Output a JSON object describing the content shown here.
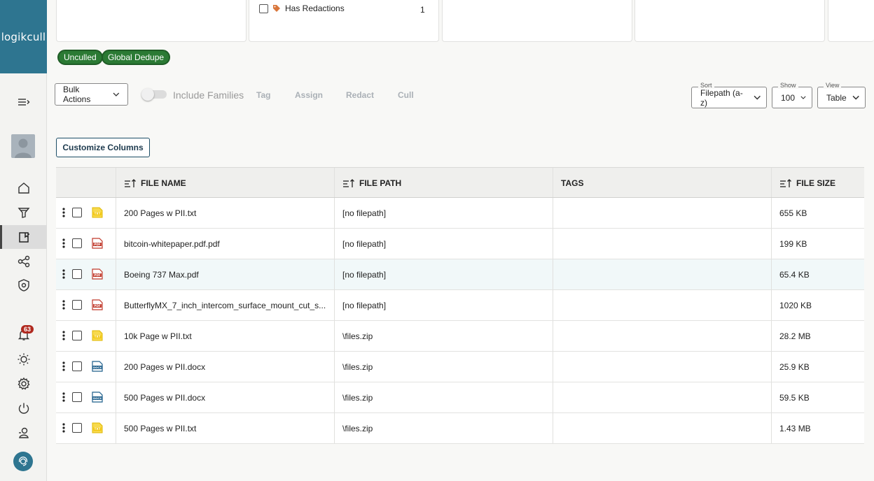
{
  "app": {
    "logo": "logikcull"
  },
  "sidebar": {
    "items": [
      {
        "name": "collapse-menu-icon"
      },
      {
        "name": "home-icon"
      },
      {
        "name": "upload-funnel-icon"
      },
      {
        "name": "review-book-icon",
        "active": true
      },
      {
        "name": "share-network-icon"
      },
      {
        "name": "shield-icon"
      },
      {
        "name": "notifications-bell-icon"
      },
      {
        "name": "sun-icon"
      },
      {
        "name": "settings-gear-icon"
      },
      {
        "name": "power-icon"
      },
      {
        "name": "account-icon"
      },
      {
        "name": "support-icon"
      }
    ],
    "notification_count": "63"
  },
  "facets": {
    "has_redactions_label": "Has Redactions",
    "has_redactions_count": "1"
  },
  "filters": {
    "pills": [
      "Unculled",
      "Global Dedupe"
    ],
    "pill_color": "#2b7a34"
  },
  "toolbar": {
    "bulk_actions": "Bulk Actions",
    "include_families": "Include Families",
    "actions": [
      "Tag",
      "Assign",
      "Redact",
      "Cull"
    ],
    "sort_label": "Sort",
    "sort_value": "Filepath (a-z)",
    "show_label": "Show",
    "show_value": "100",
    "view_label": "View",
    "view_value": "Table",
    "customize_columns": "Customize Columns"
  },
  "table": {
    "columns": [
      "FILE NAME",
      "FILE PATH",
      "TAGS",
      "FILE SIZE"
    ],
    "rows": [
      {
        "icon": "txt",
        "name": "200 Pages w PII.txt",
        "path": "[no filepath]",
        "tags": "",
        "size": "655 KB"
      },
      {
        "icon": "pdf",
        "name": "bitcoin-whitepaper.pdf.pdf",
        "path": "[no filepath]",
        "tags": "",
        "size": "199 KB"
      },
      {
        "icon": "pdf",
        "name": "Boeing 737 Max.pdf",
        "path": "[no filepath]",
        "tags": "",
        "size": "65.4 KB"
      },
      {
        "icon": "pdf",
        "name": "ButterflyMX_7_inch_intercom_surface_mount_cut_s...",
        "path": "[no filepath]",
        "tags": "",
        "size": "1020 KB"
      },
      {
        "icon": "txt",
        "name": "10k Page w PII.txt",
        "path": "\\files.zip",
        "tags": "",
        "size": "28.2 MB"
      },
      {
        "icon": "docx",
        "name": "200 Pages w PII.docx",
        "path": "\\files.zip",
        "tags": "",
        "size": "25.9 KB"
      },
      {
        "icon": "docx",
        "name": "500 Pages w PII.docx",
        "path": "\\files.zip",
        "tags": "",
        "size": "59.5 KB"
      },
      {
        "icon": "txt",
        "name": "500 Pages w PII.txt",
        "path": "\\files.zip",
        "tags": "",
        "size": "1.43 MB"
      }
    ]
  },
  "colors": {
    "brand": "#2e7590",
    "pdf": "#c0392b",
    "txt": "#f2c300",
    "docx": "#1f5f8b",
    "badge": "#b0291f"
  }
}
